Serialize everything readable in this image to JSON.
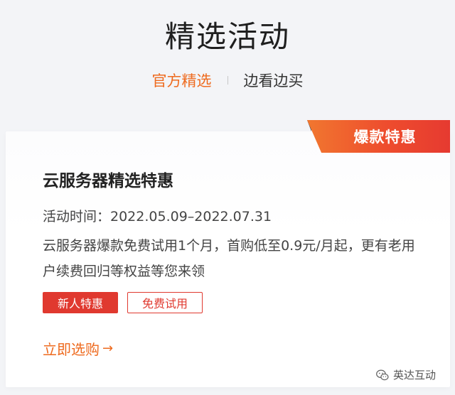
{
  "header": {
    "title": "精选活动"
  },
  "tabs": [
    {
      "label": "官方精选",
      "active": true
    },
    {
      "label": "边看边买",
      "active": false
    }
  ],
  "card": {
    "badge": "爆款特惠",
    "title": "云服务器精选特惠",
    "date_line": "活动时间：2022.05.09–2022.07.31",
    "description": "云服务器爆款免费试用1个月，首购低至0.9元/月起，更有老用户续费回归等权益等您来领",
    "tags": [
      {
        "label": "新人特惠",
        "style": "filled"
      },
      {
        "label": "免费试用",
        "style": "outline"
      }
    ],
    "cta": "立即选购",
    "cta_arrow": "→"
  },
  "watermark": {
    "text": "英达互动",
    "icon": "wechat-icon"
  },
  "colors": {
    "accent_orange": "#ee6a1e",
    "accent_red": "#e0392f",
    "background": "#f3f4f7"
  }
}
